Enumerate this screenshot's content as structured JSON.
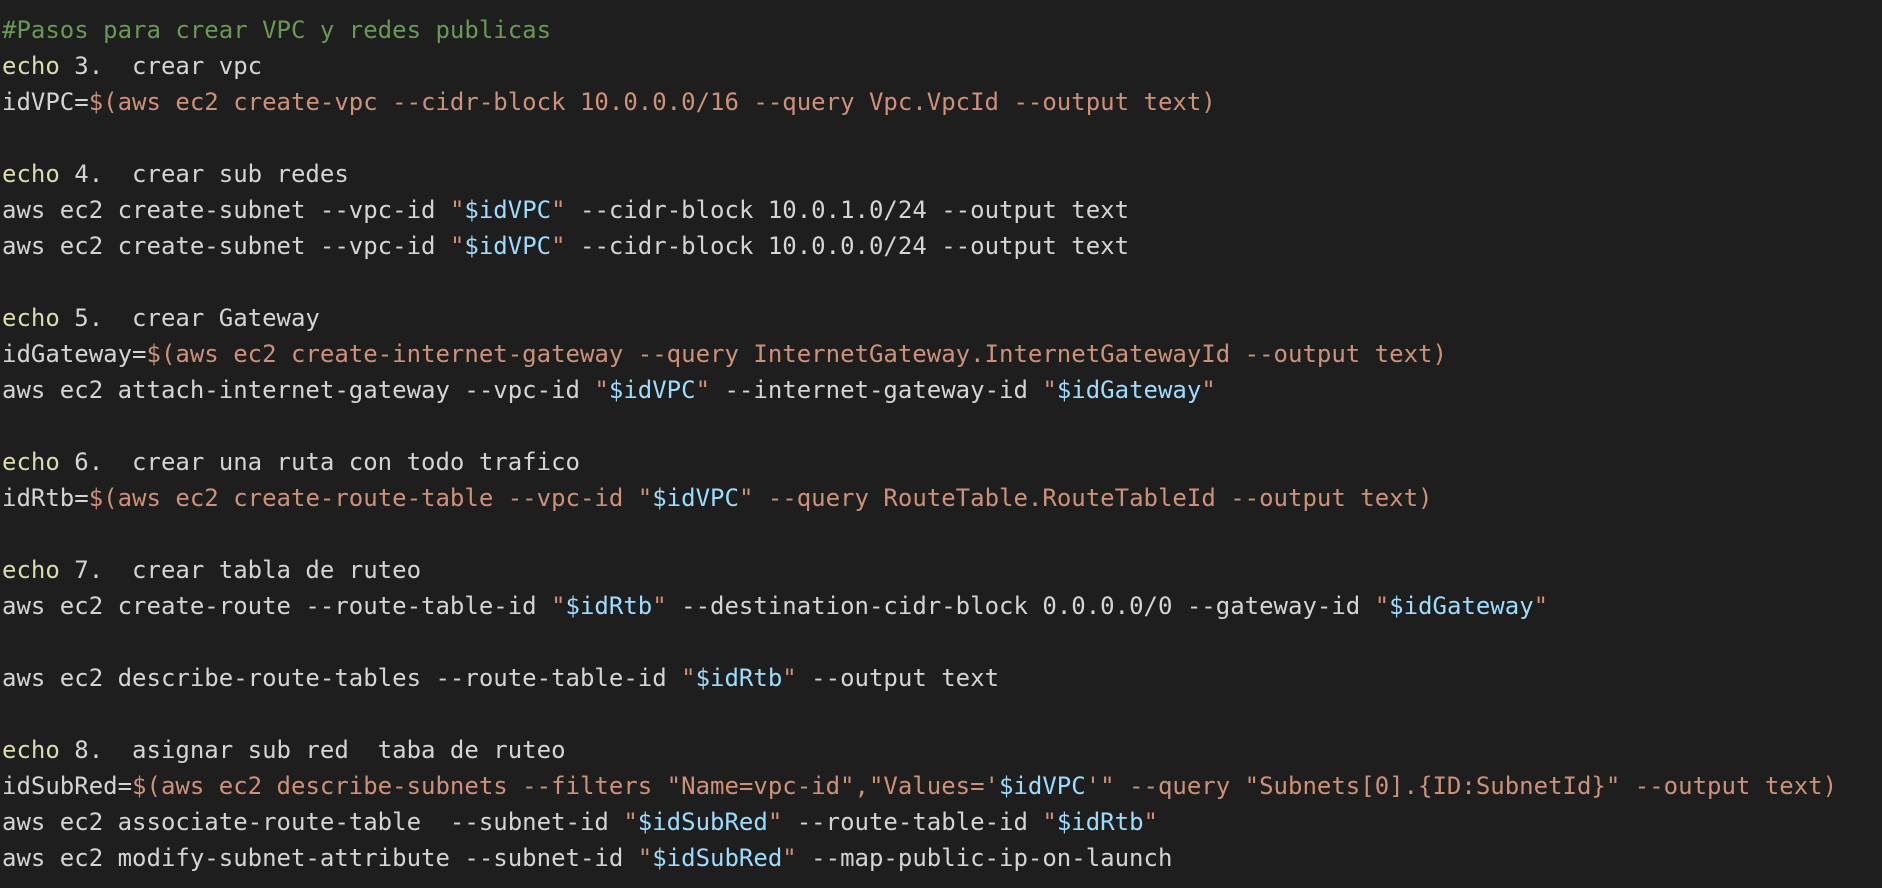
{
  "editor": {
    "colors": {
      "background": "#1e1e1e",
      "plain": "#d4d4d4",
      "comment": "#6a9955",
      "builtin": "#dcdcaa",
      "string": "#ce9178",
      "variable": "#9cdcfe"
    },
    "lines": [
      [
        [
          "comment",
          "#Pasos para crear VPC y redes publicas"
        ]
      ],
      [
        [
          "builtin",
          "echo"
        ],
        [
          "plain",
          " 3.  crear vpc"
        ]
      ],
      [
        [
          "plain",
          "idVPC="
        ],
        [
          "str",
          "$(aws ec2 create-vpc --cidr-block 10.0.0.0/16 --query Vpc.VpcId --output text)"
        ]
      ],
      [],
      [
        [
          "builtin",
          "echo"
        ],
        [
          "plain",
          " 4.  crear sub redes"
        ]
      ],
      [
        [
          "plain",
          "aws ec2 create-subnet --vpc-id "
        ],
        [
          "str",
          "\""
        ],
        [
          "var",
          "$idVPC"
        ],
        [
          "str",
          "\""
        ],
        [
          "plain",
          " --cidr-block 10.0.1.0/24 --output text"
        ]
      ],
      [
        [
          "plain",
          "aws ec2 create-subnet --vpc-id "
        ],
        [
          "str",
          "\""
        ],
        [
          "var",
          "$idVPC"
        ],
        [
          "str",
          "\""
        ],
        [
          "plain",
          " --cidr-block 10.0.0.0/24 --output text"
        ]
      ],
      [],
      [
        [
          "builtin",
          "echo"
        ],
        [
          "plain",
          " 5.  crear Gateway"
        ]
      ],
      [
        [
          "plain",
          "idGateway="
        ],
        [
          "str",
          "$(aws ec2 create-internet-gateway --query InternetGateway.InternetGatewayId --output text)"
        ]
      ],
      [
        [
          "plain",
          "aws ec2 attach-internet-gateway --vpc-id "
        ],
        [
          "str",
          "\""
        ],
        [
          "var",
          "$idVPC"
        ],
        [
          "str",
          "\""
        ],
        [
          "plain",
          " --internet-gateway-id "
        ],
        [
          "str",
          "\""
        ],
        [
          "var",
          "$idGateway"
        ],
        [
          "str",
          "\""
        ]
      ],
      [],
      [
        [
          "builtin",
          "echo"
        ],
        [
          "plain",
          " 6.  crear una ruta con todo trafico"
        ]
      ],
      [
        [
          "plain",
          "idRtb="
        ],
        [
          "str",
          "$(aws ec2 create-route-table --vpc-id \""
        ],
        [
          "var",
          "$idVPC"
        ],
        [
          "str",
          "\" --query RouteTable.RouteTableId --output text)"
        ]
      ],
      [],
      [
        [
          "builtin",
          "echo"
        ],
        [
          "plain",
          " 7.  crear tabla de ruteo"
        ]
      ],
      [
        [
          "plain",
          "aws ec2 create-route --route-table-id "
        ],
        [
          "str",
          "\""
        ],
        [
          "var",
          "$idRtb"
        ],
        [
          "str",
          "\""
        ],
        [
          "plain",
          " --destination-cidr-block 0.0.0.0/0 --gateway-id "
        ],
        [
          "str",
          "\""
        ],
        [
          "var",
          "$idGateway"
        ],
        [
          "str",
          "\""
        ]
      ],
      [],
      [
        [
          "plain",
          "aws ec2 describe-route-tables --route-table-id "
        ],
        [
          "str",
          "\""
        ],
        [
          "var",
          "$idRtb"
        ],
        [
          "str",
          "\""
        ],
        [
          "plain",
          " --output text"
        ]
      ],
      [],
      [
        [
          "builtin",
          "echo"
        ],
        [
          "plain",
          " 8.  asignar sub red  taba de ruteo"
        ]
      ],
      [
        [
          "plain",
          "idSubRed="
        ],
        [
          "str",
          "$(aws ec2 describe-subnets --filters \"Name=vpc-id\",\"Values='"
        ],
        [
          "var",
          "$idVPC"
        ],
        [
          "str",
          "'\" --query \"Subnets[0].{ID:SubnetId}\" --output text)"
        ]
      ],
      [
        [
          "plain",
          "aws ec2 associate-route-table  --subnet-id "
        ],
        [
          "str",
          "\""
        ],
        [
          "var",
          "$idSubRed"
        ],
        [
          "str",
          "\""
        ],
        [
          "plain",
          " --route-table-id "
        ],
        [
          "str",
          "\""
        ],
        [
          "var",
          "$idRtb"
        ],
        [
          "str",
          "\""
        ]
      ],
      [
        [
          "plain",
          "aws ec2 modify-subnet-attribute --subnet-id "
        ],
        [
          "str",
          "\""
        ],
        [
          "var",
          "$idSubRed"
        ],
        [
          "str",
          "\""
        ],
        [
          "plain",
          " --map-public-ip-on-launch"
        ]
      ]
    ]
  }
}
